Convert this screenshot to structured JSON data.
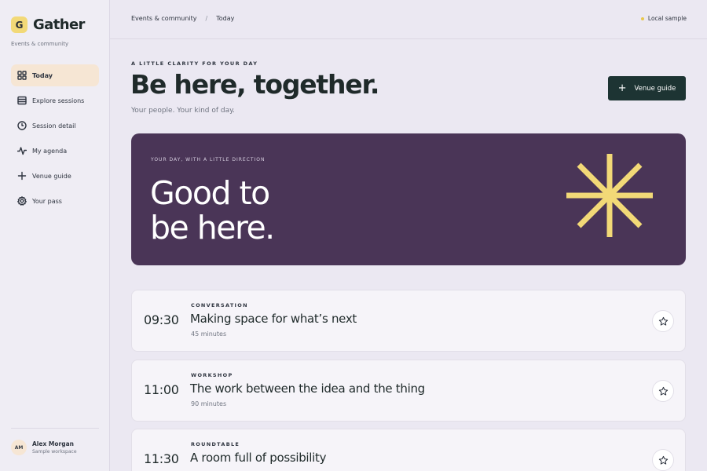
{
  "brand": {
    "mark": "G",
    "name": "Gather",
    "subtitle": "Events & community"
  },
  "nav": [
    {
      "label": "Today",
      "icon": "grid-icon",
      "active": true
    },
    {
      "label": "Explore sessions",
      "icon": "list-icon"
    },
    {
      "label": "Session detail",
      "icon": "clock-icon"
    },
    {
      "label": "My agenda",
      "icon": "activity-icon"
    },
    {
      "label": "Venue guide",
      "icon": "plus-icon"
    },
    {
      "label": "Your pass",
      "icon": "gear-icon"
    }
  ],
  "user": {
    "initials": "AM",
    "name": "Alex Morgan",
    "workspace": "Sample workspace"
  },
  "breadcrumb": [
    "Events & community",
    "Today"
  ],
  "breadcrumb_separator": "/",
  "status": {
    "label": "Local sample",
    "dot_color": "#e9c84c"
  },
  "header": {
    "eyebrow": "A LITTLE CLARITY FOR YOUR DAY",
    "title": "Be here, together.",
    "subtitle": "Your people. Your kind of day.",
    "action_label": "Venue guide",
    "action_icon": "plus-icon"
  },
  "hero": {
    "eyebrow": "YOUR DAY, WITH A LITTLE DIRECTION",
    "title_line1": "Good to",
    "title_line2": "be here.",
    "icon": "asterisk-icon",
    "background_color": "#4a3557",
    "accent_color": "#f2d977"
  },
  "sessions": [
    {
      "time": "09:30",
      "kind": "CONVERSATION",
      "title": "Making space for what’s next",
      "duration": "45 minutes",
      "icon": "star-icon"
    },
    {
      "time": "11:00",
      "kind": "WORKSHOP",
      "title": "The work between the idea and the thing",
      "duration": "90 minutes",
      "icon": "star-icon"
    },
    {
      "time": "11:30",
      "kind": "ROUNDTABLE",
      "title": "A room full of possibility",
      "duration": "",
      "icon": "star-icon"
    }
  ],
  "colors": {
    "primary_dark": "#1d3433",
    "accent": "#f2d977",
    "nav_active": "#f6e6d4",
    "background": "#ebe8f2"
  }
}
